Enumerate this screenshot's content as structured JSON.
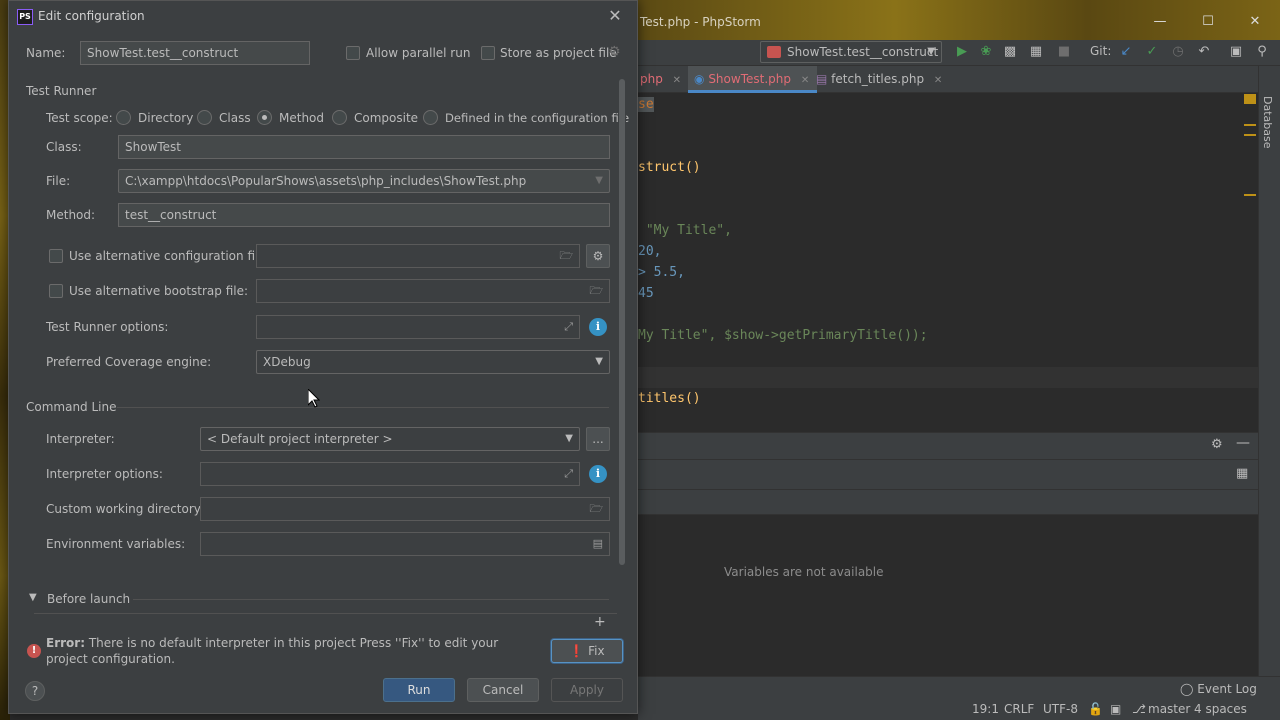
{
  "ide": {
    "title": "ShowTest.php - PhpStorm",
    "title_visible": "Test.php - PhpStorm",
    "run_config": "ShowTest.test__construct",
    "git_label": "Git:",
    "tabs": [
      {
        "label": "php",
        "active": false
      },
      {
        "label": "ShowTest.php",
        "active": true
      },
      {
        "label": "fetch_titles.php",
        "active": false
      }
    ],
    "right_panel_label": "Database",
    "code_lines": [
      {
        "text": "se"
      },
      {
        "text": "struct()"
      },
      {
        "text": "\"My Title\","
      },
      {
        "text": "20,"
      },
      {
        "text": "> 5.5,"
      },
      {
        "text": "45"
      },
      {
        "text": "My Title\", $show->getPrimaryTitle());"
      },
      {
        "text": "titles()"
      }
    ],
    "variables_empty": "Variables are not available",
    "status": {
      "event_log": "Event Log",
      "position": "19:1",
      "line_sep": "CRLF",
      "encoding": "UTF-8",
      "branch": "master",
      "indent": "4 spaces"
    },
    "accent_colors": {
      "run": "#499c54",
      "debug": "#4a88c7",
      "error": "#c75450"
    }
  },
  "dialog": {
    "title": "Edit configuration",
    "name_label": "Name:",
    "name_value": "ShowTest.test__construct",
    "allow_parallel_label": "Allow parallel run",
    "store_project_label": "Store as project file",
    "test_runner_section": "Test Runner",
    "test_scope_label": "Test scope:",
    "scope_options": [
      "Directory",
      "Class",
      "Method",
      "Composite",
      "Defined in the configuration file"
    ],
    "scope_selected": "Method",
    "class_label": "Class:",
    "class_value": "ShowTest",
    "file_label": "File:",
    "file_value": "C:\\xampp\\htdocs\\PopularShows\\assets\\php_includes\\ShowTest.php",
    "method_label": "Method:",
    "method_value": "test__construct",
    "alt_config_label": "Use alternative configuration file:",
    "alt_bootstrap_label": "Use alternative bootstrap file:",
    "runner_options_label": "Test Runner options:",
    "coverage_label": "Preferred Coverage engine:",
    "coverage_value": "XDebug",
    "command_line_section": "Command Line",
    "interpreter_label": "Interpreter:",
    "interpreter_value": "< Default project interpreter >",
    "interpreter_options_label": "Interpreter options:",
    "working_dir_label": "Custom working directory:",
    "env_vars_label": "Environment variables:",
    "before_launch_label": "Before launch",
    "error_prefix": "Error:",
    "error_message": "There is no default interpreter in this project Press ''Fix'' to edit your project configuration.",
    "fix_label": "Fix",
    "run_label": "Run",
    "cancel_label": "Cancel",
    "apply_label": "Apply",
    "help_label": "?",
    "browse_label": "...",
    "add_label": "+"
  }
}
